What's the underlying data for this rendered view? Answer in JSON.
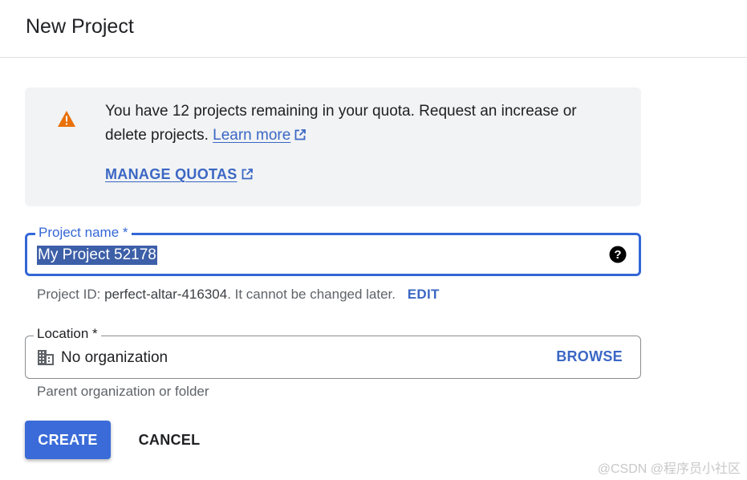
{
  "header": {
    "title": "New Project"
  },
  "quota_banner": {
    "icon": "warning-icon",
    "icon_color": "#e8710a",
    "message": "You have 12 projects remaining in your quota. Request an increase or delete projects.",
    "learn_more": "Learn more",
    "manage_quotas": "MANAGE QUOTAS"
  },
  "project_name": {
    "label": "Project name *",
    "value": "My Project 52178",
    "help_icon": "help-icon"
  },
  "project_id": {
    "prefix": "Project ID:",
    "value": "perfect-altar-416304",
    "suffix": ". It cannot be changed later.",
    "edit_label": "EDIT"
  },
  "location": {
    "label": "Location *",
    "icon": "building-icon",
    "value": "No organization",
    "browse_label": "BROWSE",
    "hint": "Parent organization or folder"
  },
  "actions": {
    "create_label": "CREATE",
    "cancel_label": "CANCEL"
  },
  "watermark": "@CSDN @程序员小社区",
  "colors": {
    "accent": "#3367d6",
    "link": "#3b67c4",
    "banner_bg": "#f1f3f4",
    "selection_bg": "#3d5fa8"
  }
}
